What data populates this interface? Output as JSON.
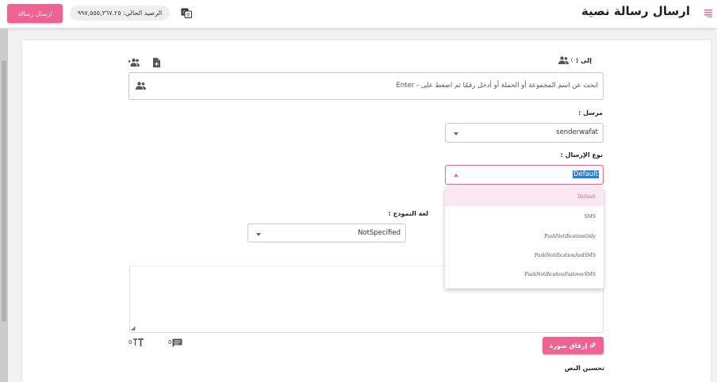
{
  "header": {
    "title": "ارسال رسالة نصية",
    "send_button": "ارسال رسالة",
    "balance": "الرصيد الحالي: ٩٩٧,٥٥٥,٣٦٧.٢٥"
  },
  "recipients": {
    "label": "إلى :",
    "count": "(٠)",
    "placeholder": "ابحث عن اسم المجموعة أو الحملة أو أدخل رقمًا ثم اضغط على - Enter"
  },
  "sender": {
    "label": "مرسل :",
    "value": "senderwafat"
  },
  "send_type": {
    "label": "نوع الإرسال :",
    "value": "Default",
    "options": [
      "Default",
      "SMS",
      "PushNotificationOnly",
      "PushNotificationAndSMS",
      "PushNotificationFailoverSMS"
    ]
  },
  "template_language": {
    "label": "لغة النموذج :",
    "value": "NotSpecified"
  },
  "message": {
    "font_count": "0",
    "message_count": "0"
  },
  "attach_image_label": "إرفاق صورة",
  "improve_text_label": "تحسين النص",
  "colors": {
    "accent": "#f06292",
    "selection": "#2f7bd6",
    "option_active_bg": "#fbe7ef"
  },
  "icons": {
    "menu": "menu-icon",
    "translate": "translate-icon",
    "people": "people-icon",
    "add_group": "add-group-icon",
    "file": "file-icon",
    "text_size": "text-size-icon",
    "message": "message-icon",
    "attach": "paperclip-icon"
  }
}
